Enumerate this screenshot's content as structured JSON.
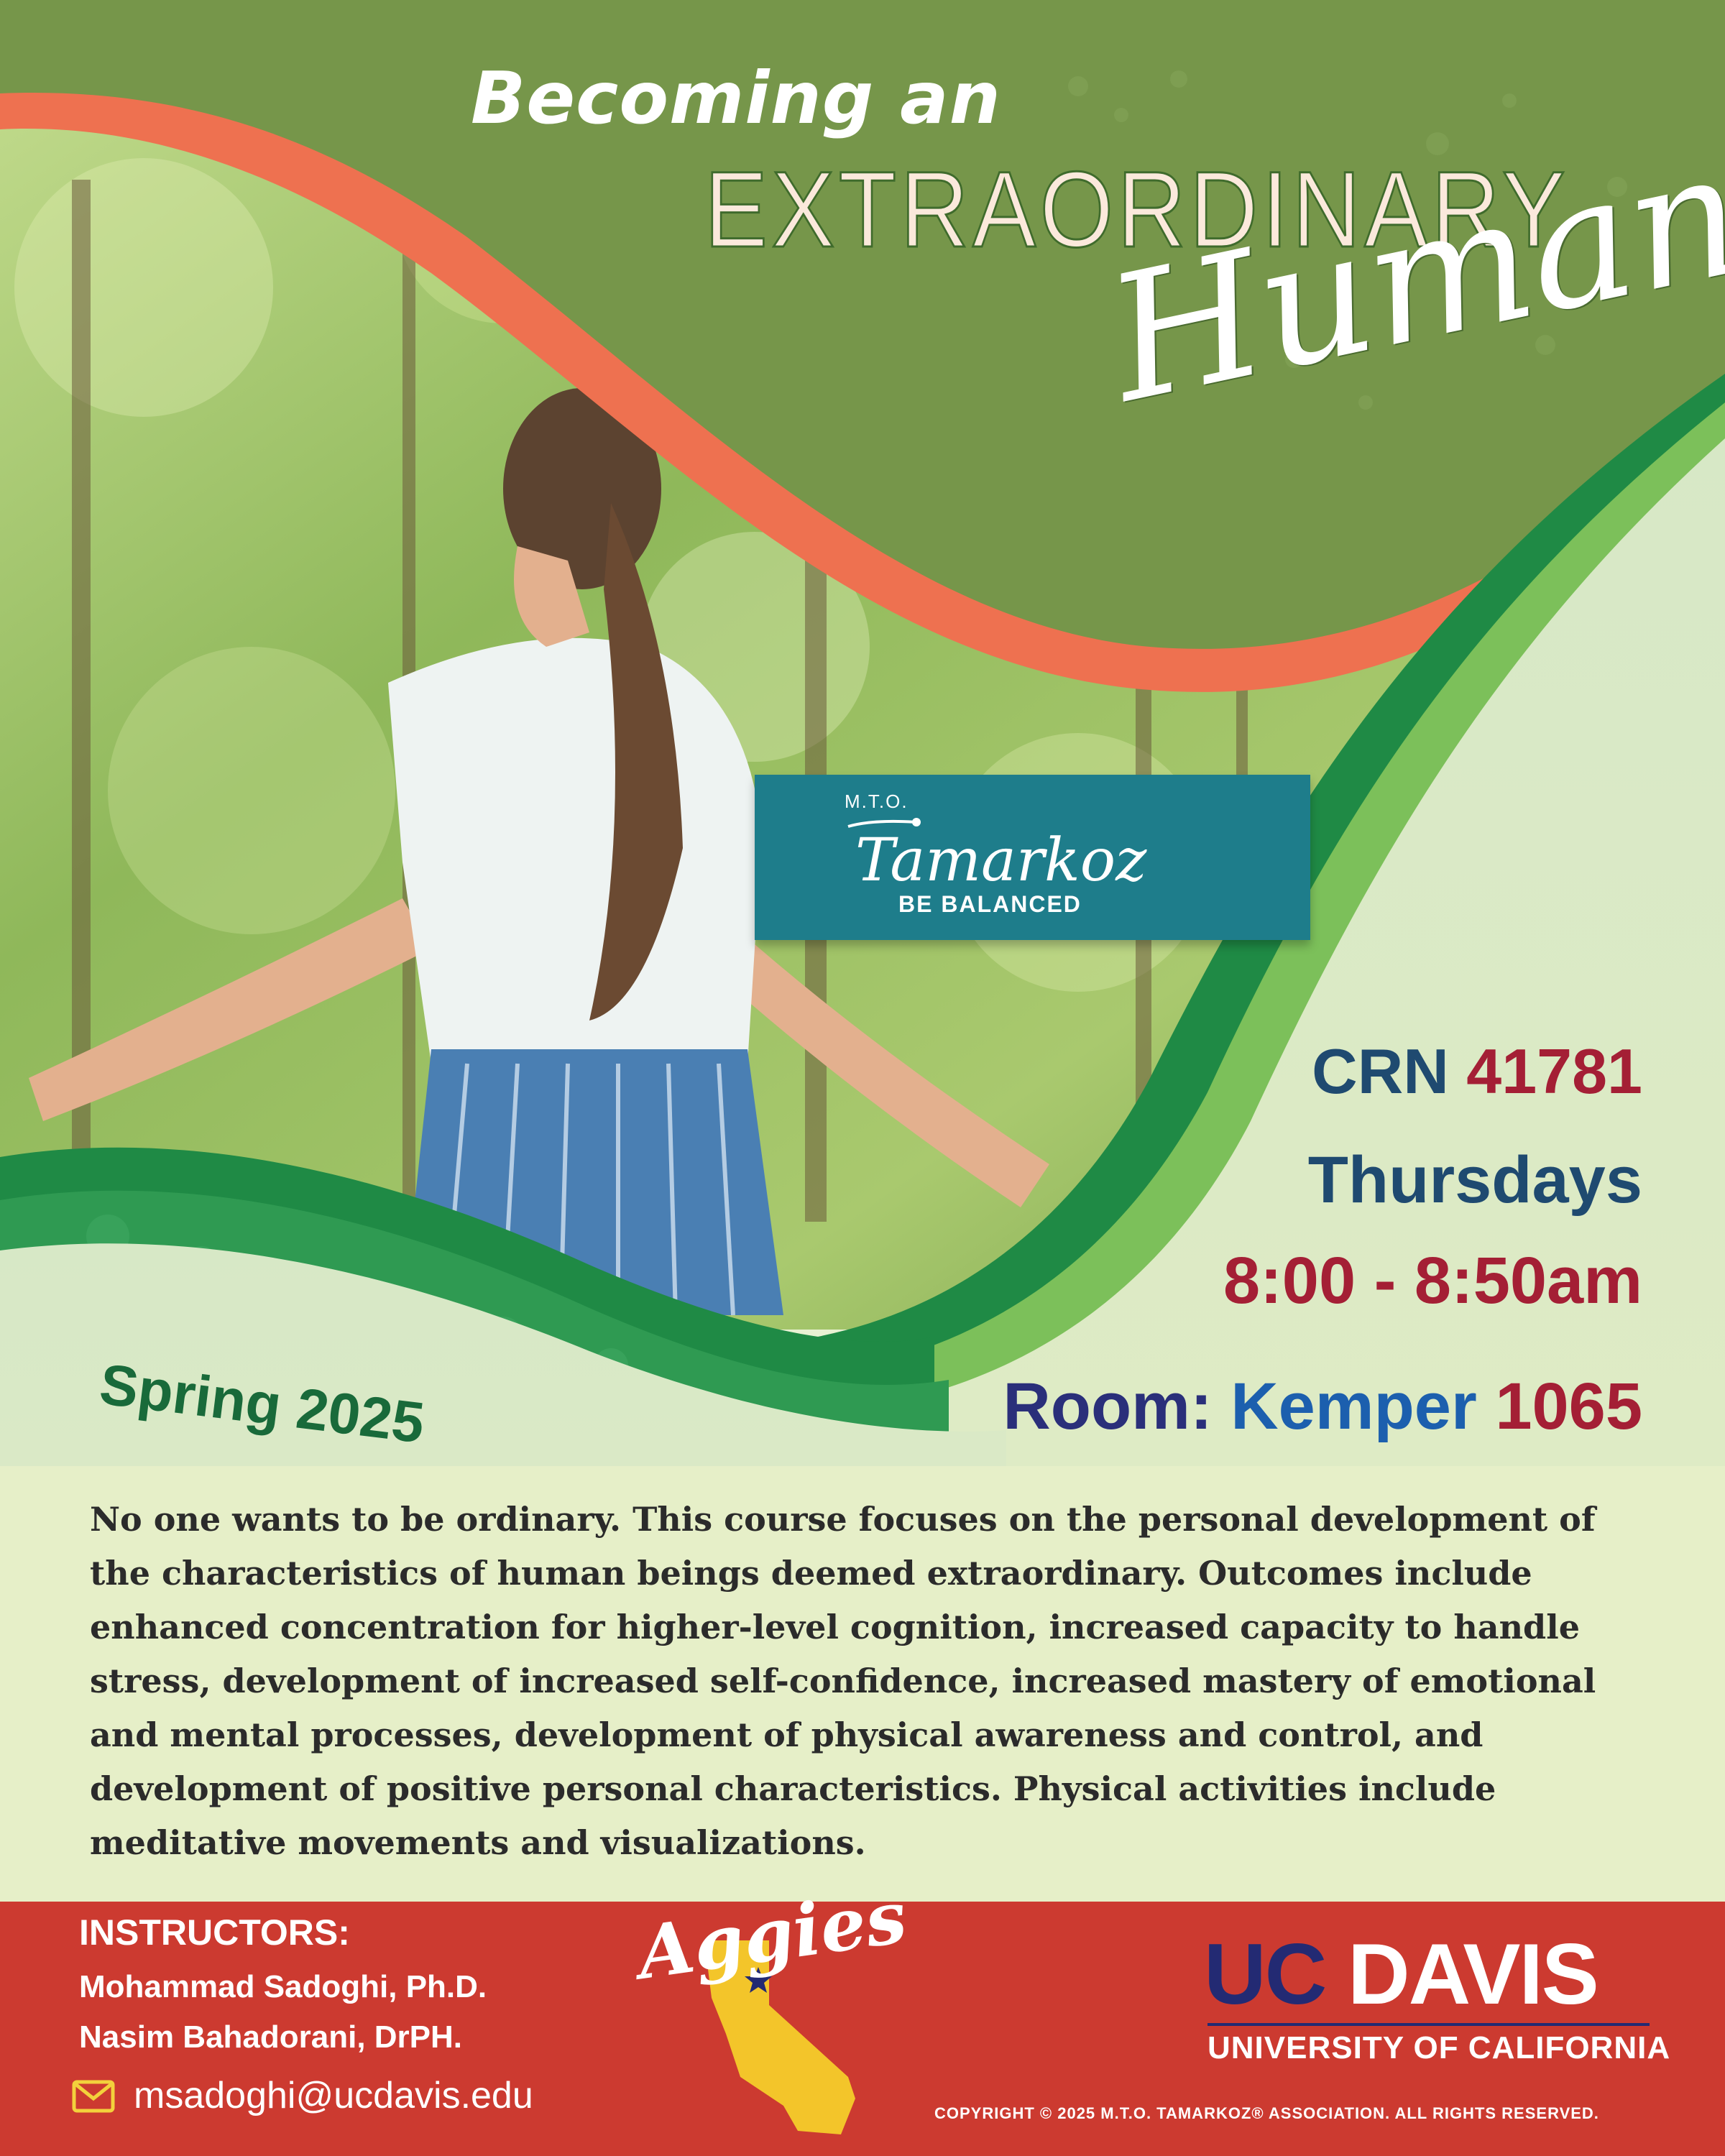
{
  "header": {
    "line1": "Becoming an",
    "line2": "EXTRAORDINARY",
    "line3": "Human"
  },
  "logo": {
    "brand_top": "M.T.O.",
    "brand_name": "Tamarkoz",
    "tagline": "BE BALANCED"
  },
  "course": {
    "crn_label": "CRN",
    "crn_number": "41781",
    "day": "Thursdays",
    "time": "8:00 - 8:50am",
    "room_label": "Room:",
    "room_building": "Kemper",
    "room_number": "1065",
    "season": "Spring 2025"
  },
  "description": "No one wants to be ordinary. This course focuses on the personal development of the characteristics of human beings deemed extraordinary. Outcomes include enhanced concentration for higher-level cognition, increased capacity to handle stress, development of increased self-confidence, increased mastery of emotional and mental processes, development of physical awareness and control, and development of positive personal characteristics. Physical activities include meditative movements and visualizations.",
  "footer": {
    "instructors_title": "INSTRUCTORS:",
    "instructors": [
      "Mohammad Sadoghi, Ph.D.",
      "Nasim Bahadorani, DrPH."
    ],
    "email": "msadoghi@ucdavis.edu",
    "aggies": "Aggies",
    "university_part1": "UC",
    "university_part2": "DAVIS",
    "university_sub": "UNIVERSITY OF CALIFORNIA",
    "copyright": "COPYRIGHT © 2025 M.T.O. TAMARKOZ® ASSOCIATION.  ALL RIGHTS RESERVED."
  },
  "colors": {
    "header_green": "#76964a",
    "accent_orange": "#ee7150",
    "dark_green": "#1f8a45",
    "footer_red": "#cc3a30",
    "navy": "#1f4a70",
    "crimson": "#a41f35",
    "ucd_navy": "#232a73"
  },
  "icons": [
    "envelope-icon",
    "california-map-icon",
    "star-icon",
    "tamarkoz-figure-icon"
  ]
}
